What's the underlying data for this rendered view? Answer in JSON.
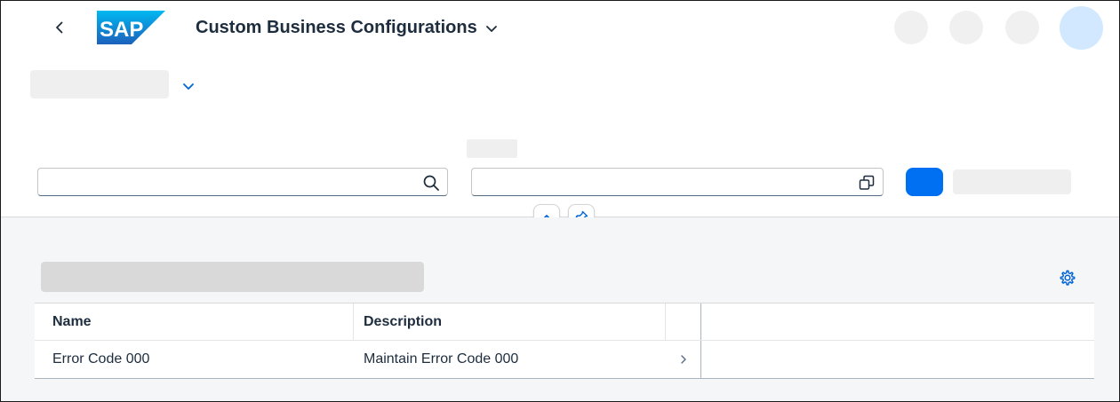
{
  "shell": {
    "logo_text": "SAP",
    "app_title": "Custom Business Configurations",
    "icons": {
      "back": "back-chevron-icon",
      "title_dropdown": "chevron-down-icon"
    }
  },
  "filterbar": {
    "search_placeholder": "",
    "search_value": "",
    "value_help_value": "",
    "icons": {
      "search": "search-icon",
      "value_help": "value-help-icon",
      "collapse": "chevron-up-icon",
      "pin": "pin-icon"
    }
  },
  "table": {
    "columns": [
      "Name",
      "Description"
    ],
    "rows": [
      {
        "name": "Error Code 000",
        "description": "Maintain Error Code 000"
      }
    ],
    "icons": {
      "settings": "gear-icon",
      "row_nav": "chevron-right-icon"
    }
  },
  "colors": {
    "accent": "#0070f2",
    "text": "#1d2d3e",
    "content_bg": "#f5f6f7",
    "logo_blue": "#0a6ed1"
  }
}
